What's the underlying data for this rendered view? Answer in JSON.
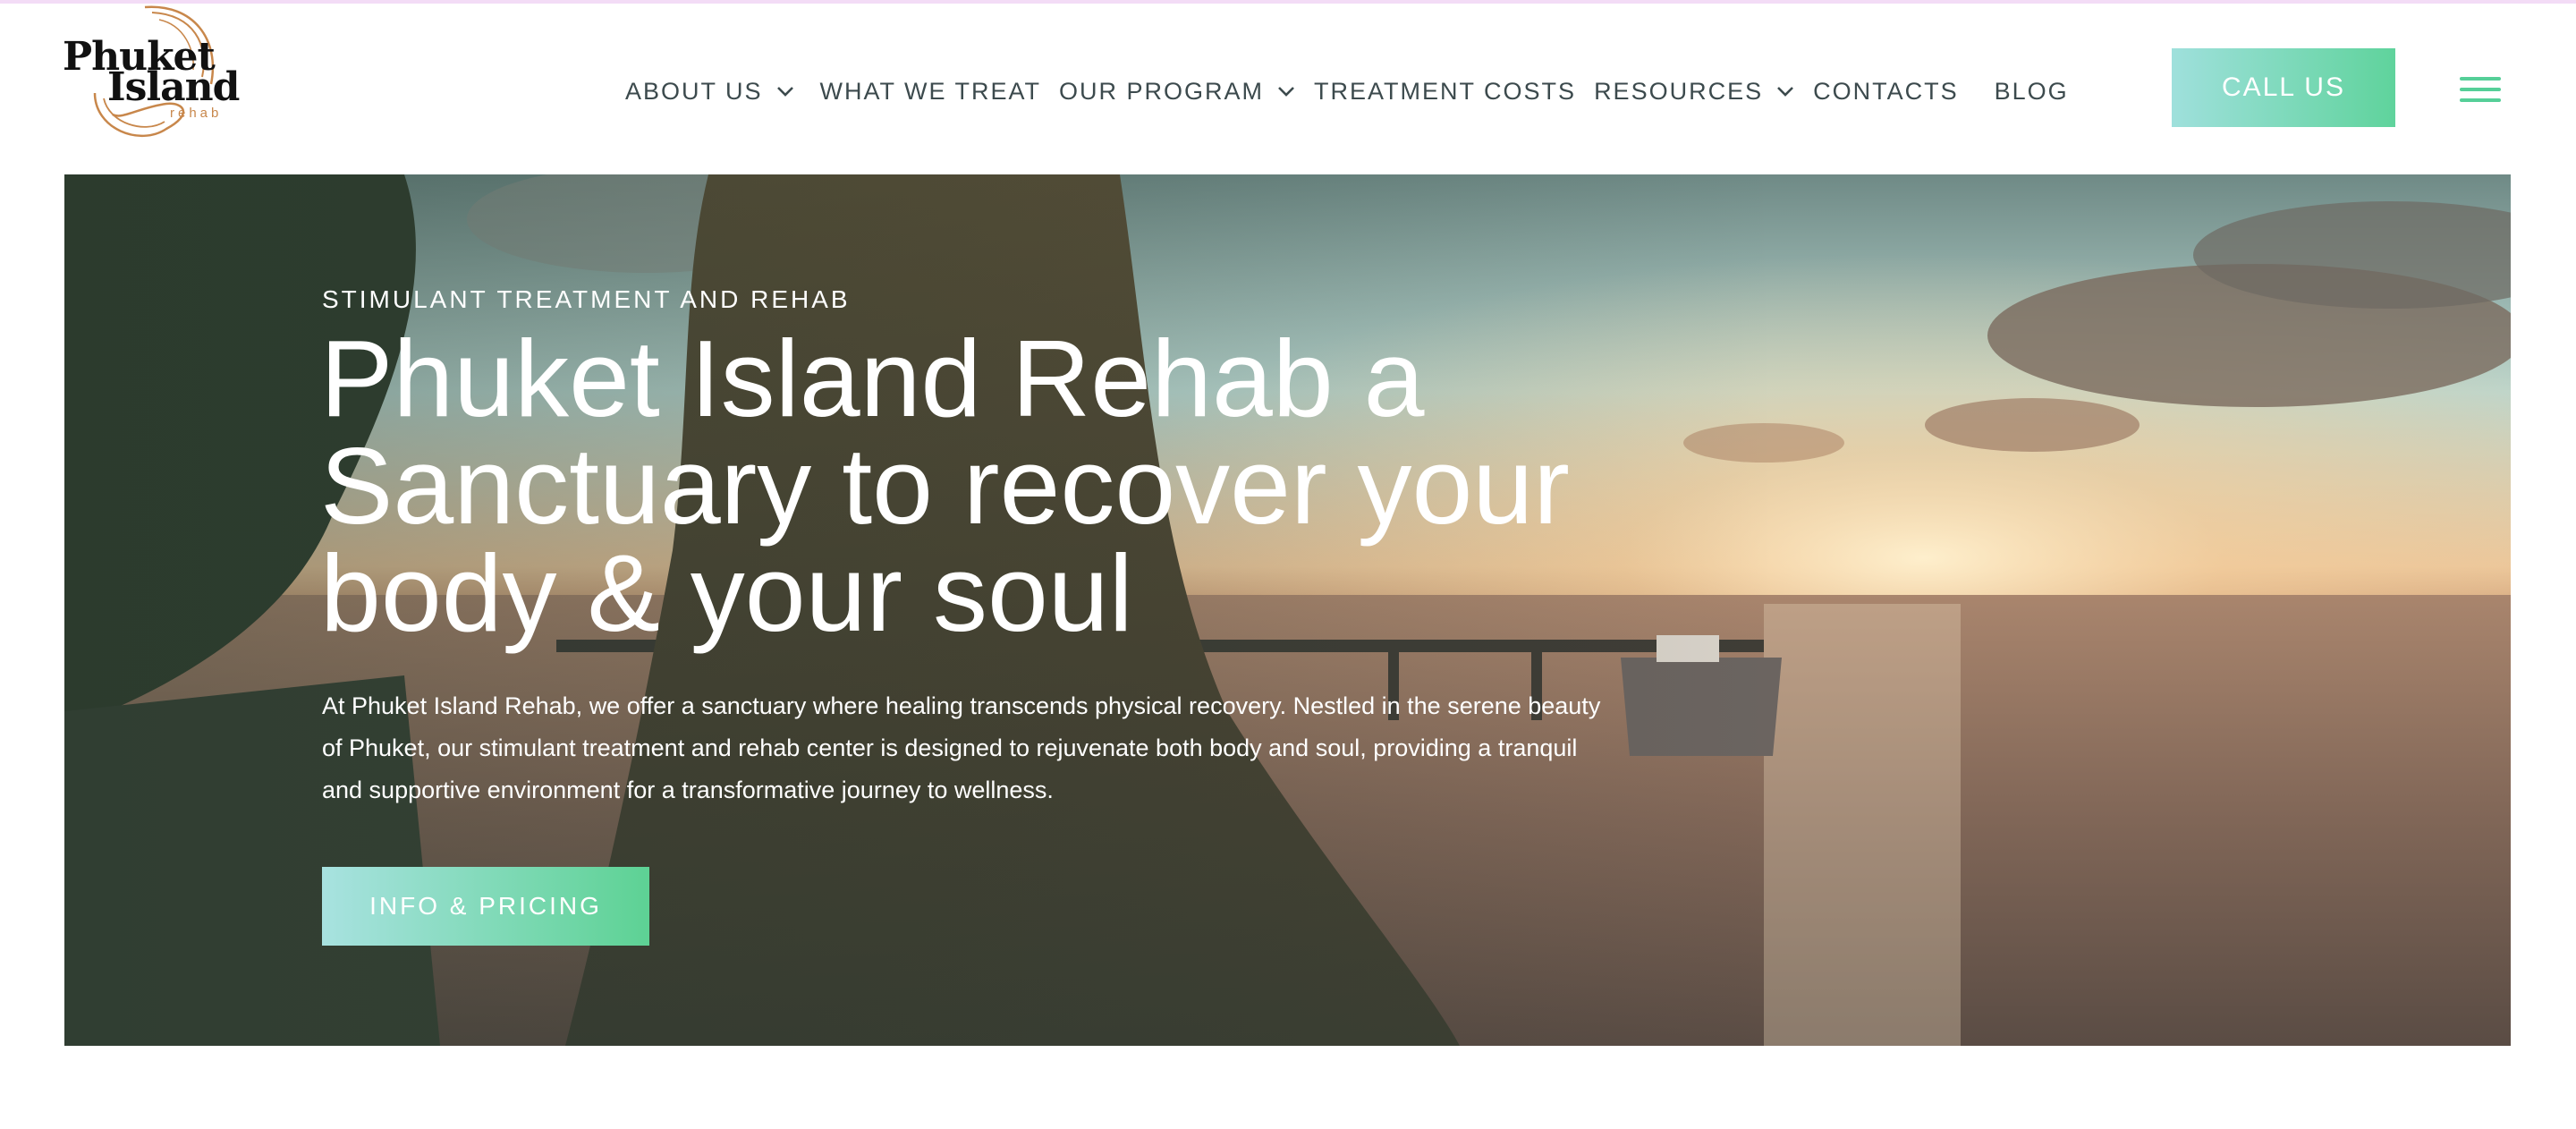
{
  "header": {
    "logo": {
      "line1": "Phuket",
      "line2": "Island",
      "line3": "rehab"
    },
    "nav": [
      {
        "label": "ABOUT US",
        "has_dropdown": true
      },
      {
        "label": "WHAT WE TREAT",
        "has_dropdown": false
      },
      {
        "label": "OUR PROGRAM",
        "has_dropdown": true
      },
      {
        "label": "TREATMENT COSTS",
        "has_dropdown": false
      },
      {
        "label": "RESOURCES",
        "has_dropdown": true
      },
      {
        "label": "CONTACTS",
        "has_dropdown": false
      },
      {
        "label": "BLOG",
        "has_dropdown": false
      }
    ],
    "call_label": "CALL US",
    "menu_icon": "hamburger-menu-icon"
  },
  "hero": {
    "kicker": "STIMULANT TREATMENT AND REHAB",
    "title_lines": [
      "Phuket Island Rehab a",
      "Sanctuary to recover your",
      "body & your soul"
    ],
    "description_lines": [
      "At Phuket Island Rehab, we offer a sanctuary where healing transcends physical recovery. Nestled in the serene beauty",
      "of Phuket, our stimulant treatment and rehab center is designed to rejuvenate both body and soul, providing a tranquil",
      "and supportive environment for a transformative journey to wellness."
    ],
    "cta_label": "INFO & PRICING"
  },
  "colors": {
    "accent_gradient_start": "#9fe0dc",
    "accent_gradient_end": "#5fd39c",
    "nav_text": "#3c4a4d",
    "logo_copper": "#c8874b"
  }
}
